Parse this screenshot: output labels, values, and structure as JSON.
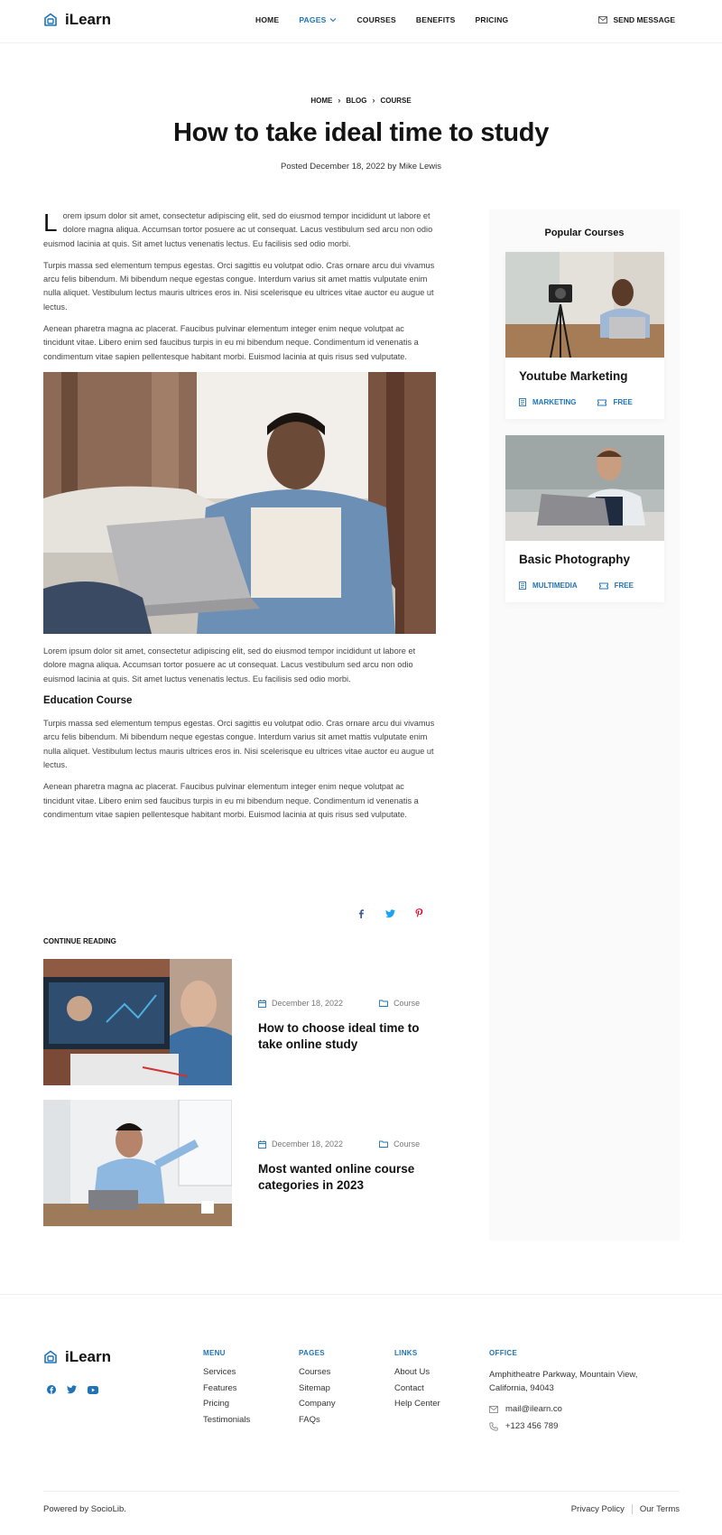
{
  "brand": {
    "name": "iLearn",
    "accent": "#1f73b7"
  },
  "nav": {
    "items": [
      "HOME",
      "PAGES",
      "COURSES",
      "BENEFITS",
      "PRICING"
    ],
    "active": "PAGES",
    "send_message": "SEND MESSAGE"
  },
  "breadcrumb": [
    "HOME",
    "BLOG",
    "COURSE"
  ],
  "post": {
    "title": "How to take ideal time to study",
    "meta": "Posted December 18, 2022 by Mike Lewis",
    "dropcap": "L",
    "p1": "orem ipsum dolor sit amet, consectetur adipiscing elit, sed do eiusmod tempor incididunt ut labore et dolore magna aliqua. Accumsan tortor posuere ac ut consequat. Lacus vestibulum sed arcu non odio euismod lacinia at quis. Sit amet luctus venenatis lectus. Eu facilisis sed odio morbi.",
    "p2": "Turpis massa sed elementum tempus egestas. Orci sagittis eu volutpat odio. Cras ornare arcu dui vivamus arcu felis bibendum. Mi bibendum neque egestas congue. Interdum varius sit amet mattis vulputate enim nulla aliquet. Vestibulum lectus mauris ultrices eros in. Nisi scelerisque eu ultrices vitae auctor eu augue ut lectus.",
    "p3": "Aenean pharetra magna ac placerat. Faucibus pulvinar elementum integer enim neque volutpat ac tincidunt vitae. Libero enim sed faucibus turpis in eu mi bibendum neque. Condimentum id venenatis a condimentum vitae sapien pellentesque habitant morbi. Euismod lacinia at quis risus sed vulputate.",
    "p4": "Lorem ipsum dolor sit amet, consectetur adipiscing elit, sed do eiusmod tempor incididunt ut labore et dolore magna aliqua. Accumsan tortor posuere ac ut consequat. Lacus vestibulum sed arcu non odio euismod lacinia at quis. Sit amet luctus venenatis lectus. Eu facilisis sed odio morbi.",
    "heading": "Education Course",
    "p5": "Turpis massa sed elementum tempus egestas. Orci sagittis eu volutpat odio. Cras ornare arcu dui vivamus arcu felis bibendum. Mi bibendum neque egestas congue. Interdum varius sit amet mattis vulputate enim nulla aliquet. Vestibulum lectus mauris ultrices eros in. Nisi scelerisque eu ultrices vitae auctor eu augue ut lectus.",
    "p6": "Aenean pharetra magna ac placerat. Faucibus pulvinar elementum integer enim neque volutpat ac tincidunt vitae. Libero enim sed faucibus turpis in eu mi bibendum neque. Condimentum id venenatis a condimentum vitae sapien pellentesque habitant morbi. Euismod lacinia at quis risus sed vulputate."
  },
  "share": {
    "icons": [
      "facebook-icon",
      "twitter-icon",
      "pinterest-icon"
    ]
  },
  "continue_reading": {
    "label": "CONTINUE READING",
    "items": [
      {
        "date": "December 18, 2022",
        "category": "Course",
        "title": "How to choose ideal time to take online study"
      },
      {
        "date": "December 18, 2022",
        "category": "Course",
        "title": "Most wanted online course categories in 2023"
      }
    ]
  },
  "sidebar": {
    "title": "Popular Courses",
    "courses": [
      {
        "title": "Youtube Marketing",
        "category": "MARKETING",
        "price": "FREE"
      },
      {
        "title": "Basic Photography",
        "category": "MULTIMEDIA",
        "price": "FREE"
      }
    ]
  },
  "footer": {
    "menu": {
      "heading": "MENU",
      "links": [
        "Services",
        "Features",
        "Pricing",
        "Testimonials"
      ]
    },
    "pages": {
      "heading": "PAGES",
      "links": [
        "Courses",
        "Sitemap",
        "Company",
        "FAQs"
      ]
    },
    "links": {
      "heading": "LINKS",
      "links": [
        "About Us",
        "Contact",
        "Help Center"
      ]
    },
    "office": {
      "heading": "OFFICE",
      "address": "Amphitheatre Parkway, Mountain View, California, 94043",
      "email": "mail@ilearn.co",
      "phone": "+123 456 789"
    },
    "socials": [
      "facebook-icon",
      "twitter-icon",
      "youtube-icon"
    ],
    "powered": "Powered by SocioLib.",
    "privacy": "Privacy Policy",
    "terms": "Our Terms"
  }
}
